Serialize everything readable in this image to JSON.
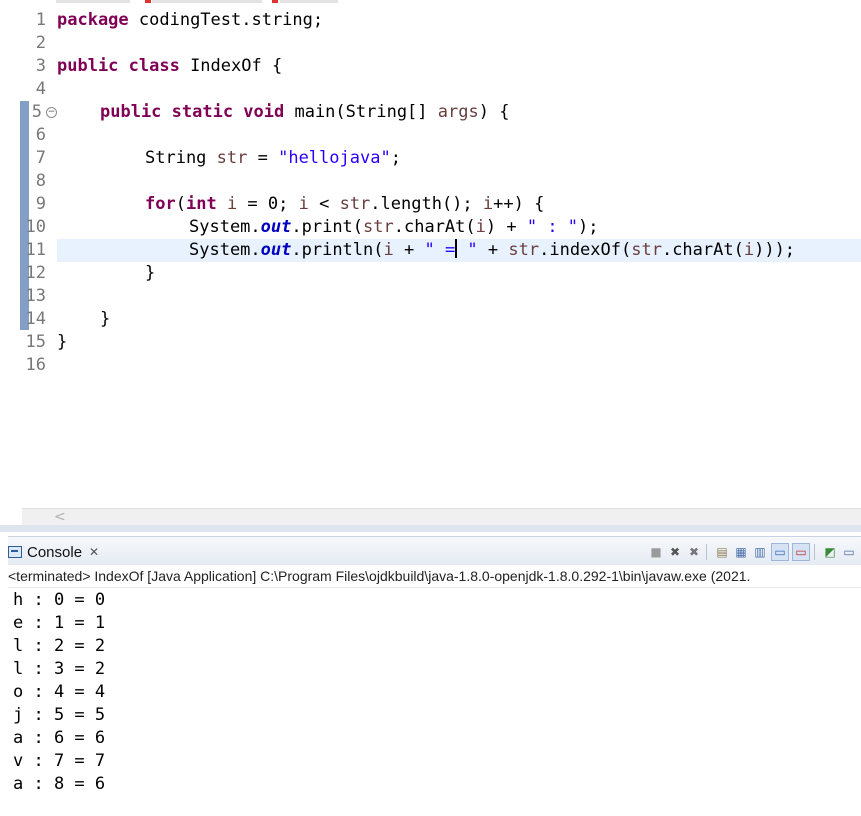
{
  "editor": {
    "line_numbers": [
      "1",
      "2",
      "3",
      "4",
      "5",
      "6",
      "7",
      "8",
      "9",
      "10",
      "11",
      "12",
      "13",
      "14",
      "15",
      "16"
    ],
    "code": {
      "l1_kw": "package",
      "l1_rest": " codingTest.string;",
      "l3_kw": "public class",
      "l3_rest": " IndexOf {",
      "l5_kw": "public static void",
      "l5_mid": " main(String[] ",
      "l5_var": "args",
      "l5_end": ") {",
      "l7_type": "String ",
      "l7_var": "str",
      "l7_op": " = ",
      "l7_str": "\"hellojava\"",
      "l7_end": ";",
      "l9_kw": "for",
      "l9_a": "(",
      "l9_kw2": "int",
      "l9_b": " ",
      "l9_i1": "i",
      "l9_c": " = 0; ",
      "l9_i2": "i",
      "l9_d": " < ",
      "l9_s": "str",
      "l9_e": ".length(); ",
      "l9_i3": "i",
      "l9_f": "++) {",
      "l10_a": "System.",
      "l10_field": "out",
      "l10_b": ".print(",
      "l10_s": "str",
      "l10_c": ".charAt(",
      "l10_i": "i",
      "l10_d": ") + ",
      "l10_str": "\" : \"",
      "l10_e": ");",
      "l11_a": "System.",
      "l11_field": "out",
      "l11_b": ".println(",
      "l11_i1": "i",
      "l11_c": " + ",
      "l11_str1": "\" =",
      "l11_str2": " \"",
      "l11_d": " + ",
      "l11_s1": "str",
      "l11_e": ".indexOf(",
      "l11_s2": "str",
      "l11_f": ".charAt(",
      "l11_i2": "i",
      "l11_g": ")));",
      "l12": "}",
      "l14": "}",
      "l15": "}"
    },
    "scroll_left_glyph": "<"
  },
  "console": {
    "tab_title": "Console",
    "close_glyph": "✕",
    "toolbar_icons": [
      "terminate-icon",
      "remove-launch-icon",
      "remove-all-terminated-icon",
      "clear-console-icon",
      "scroll-lock-icon",
      "word-wrap-icon",
      "show-on-stdout-icon",
      "show-on-stderr-icon",
      "pin-console-icon",
      "open-console-icon"
    ],
    "status": "<terminated> IndexOf [Java Application] C:\\Program Files\\ojdkbuild\\java-1.8.0-openjdk-1.8.0.292-1\\bin\\javaw.exe (2021.",
    "output": [
      "h : 0 = 0",
      "e : 1 = 1",
      "l : 2 = 2",
      "l : 3 = 2",
      "o : 4 = 4",
      "j : 5 = 5",
      "a : 6 = 6",
      "v : 7 = 7",
      "a : 8 = 6"
    ]
  },
  "colors": {
    "keyword": "#7f0055",
    "string": "#2a00ff",
    "static_field": "#0000c0",
    "local_var": "#6a3e3e",
    "current_line": "#e8f2fe",
    "change_bar": "#6f8eba"
  }
}
